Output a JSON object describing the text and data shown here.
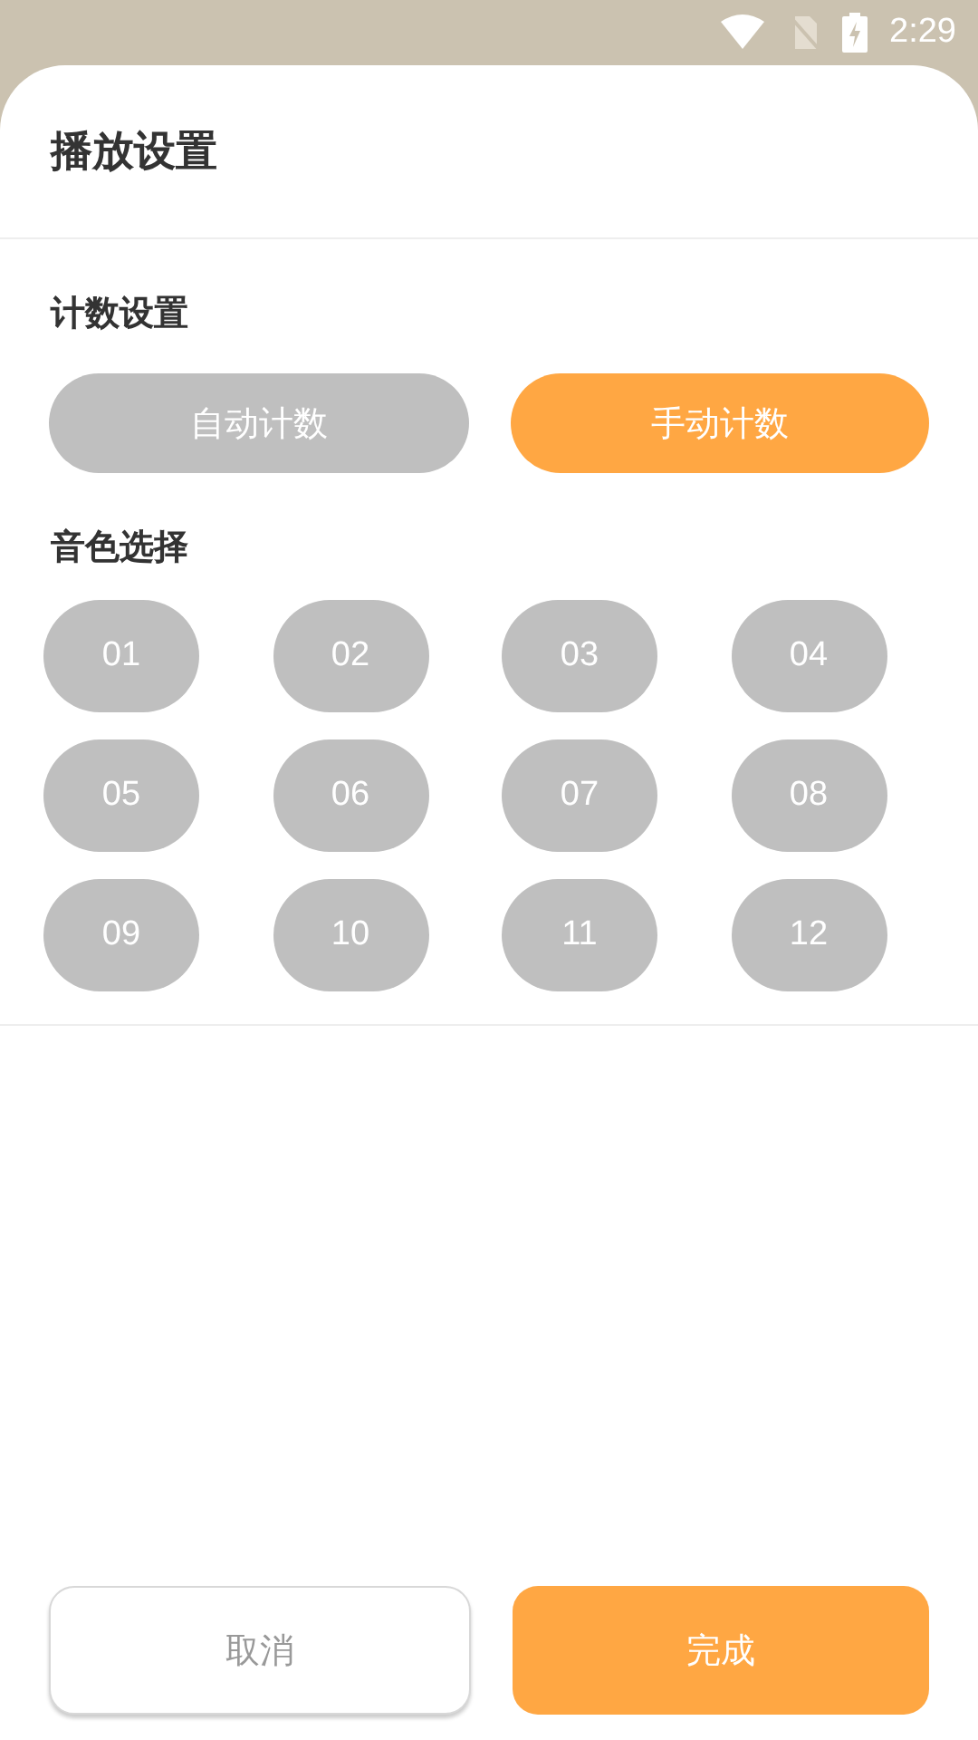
{
  "status_bar": {
    "time": "2:29"
  },
  "sheet": {
    "title": "播放设置"
  },
  "count_settings": {
    "label": "计数设置",
    "options": [
      {
        "label": "自动计数",
        "selected": false
      },
      {
        "label": "手动计数",
        "selected": true
      }
    ]
  },
  "tone_selection": {
    "label": "音色选择",
    "tones": [
      {
        "label": "01",
        "selected": false
      },
      {
        "label": "02",
        "selected": false
      },
      {
        "label": "03",
        "selected": false
      },
      {
        "label": "04",
        "selected": false
      },
      {
        "label": "05",
        "selected": false
      },
      {
        "label": "06",
        "selected": false
      },
      {
        "label": "07",
        "selected": false
      },
      {
        "label": "08",
        "selected": false
      },
      {
        "label": "09",
        "selected": false
      },
      {
        "label": "10",
        "selected": false
      },
      {
        "label": "11",
        "selected": false
      },
      {
        "label": "12",
        "selected": false
      }
    ]
  },
  "buttons": {
    "cancel": "取消",
    "done": "完成"
  }
}
